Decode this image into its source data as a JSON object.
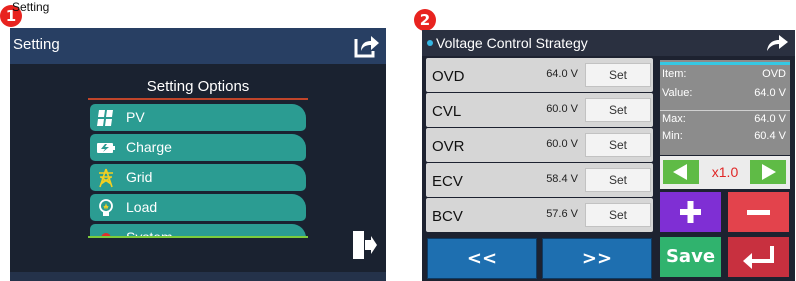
{
  "badges": [
    "1",
    "2"
  ],
  "caption": "Setting",
  "screen1": {
    "header_title": "Setting",
    "header_icon": "share-arrow-icon",
    "options_title": "Setting Options",
    "options": [
      {
        "label": "PV",
        "icon": "solar-panel-icon"
      },
      {
        "label": "Charge",
        "icon": "battery-charge-icon"
      },
      {
        "label": "Grid",
        "icon": "power-tower-icon"
      },
      {
        "label": "Load",
        "icon": "bulb-icon"
      },
      {
        "label": "System",
        "icon": "gear-icon"
      }
    ],
    "exit_icon": "exit-door-icon"
  },
  "screen2": {
    "header_title": "Voltage Control Strategy",
    "header_icon": "share-arrow-icon",
    "rows": [
      {
        "name": "OVD",
        "value": "64.0 V",
        "button": "Set"
      },
      {
        "name": "CVL",
        "value": "60.0 V",
        "button": "Set"
      },
      {
        "name": "OVR",
        "value": "60.0 V",
        "button": "Set"
      },
      {
        "name": "ECV",
        "value": "58.4 V",
        "button": "Set"
      },
      {
        "name": "BCV",
        "value": "57.6 V",
        "button": "Set"
      }
    ],
    "prev_label": "<<",
    "next_label": ">>",
    "info": {
      "item_key": "Item:",
      "item_val": "OVD",
      "value_key": "Value:",
      "value_val": "64.0 V",
      "max_key": "Max:",
      "max_val": "64.0 V",
      "min_key": "Min:",
      "min_val": "60.4 V"
    },
    "multiplier": "x1.0",
    "save_label": "Save"
  },
  "colors": {
    "screen_bg": "#1a2230",
    "header_bg": "#283f63",
    "teal_button": "#2b9c92",
    "nav_blue": "#1e6fb0",
    "arrow_green": "#5fbb46",
    "plus_purple": "#7f2fd4",
    "minus_red": "#e3434c",
    "save_green": "#30b36e",
    "enter_maroon": "#c8303f"
  }
}
